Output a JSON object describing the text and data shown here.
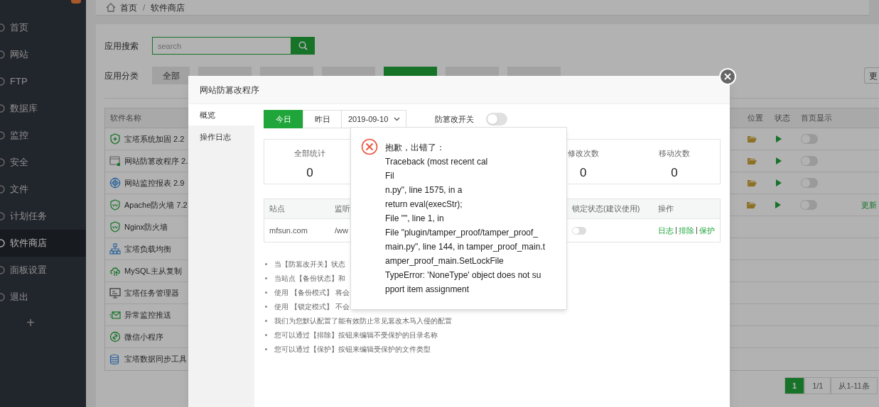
{
  "breadcrumb": [
    "首页",
    "/",
    "软件商店"
  ],
  "sidebar": {
    "items": [
      {
        "label": "首页",
        "selected": false
      },
      {
        "label": "网站",
        "selected": false
      },
      {
        "label": "FTP",
        "selected": false
      },
      {
        "label": "数据库",
        "selected": false
      },
      {
        "label": "监控",
        "selected": false
      },
      {
        "label": "安全",
        "selected": false
      },
      {
        "label": "文件",
        "selected": false
      },
      {
        "label": "计划任务",
        "selected": false
      },
      {
        "label": "软件商店",
        "selected": true
      },
      {
        "label": "面板设置",
        "selected": false
      },
      {
        "label": "退出",
        "selected": false
      }
    ],
    "add": "+"
  },
  "search": {
    "label": "应用搜索",
    "placeholder": "search"
  },
  "categories": {
    "label": "应用分类",
    "tabs": [
      {
        "label": "全部",
        "selected": false
      },
      {
        "selected": false
      },
      {
        "selected": false
      },
      {
        "selected": false
      },
      {
        "selected": true
      },
      {
        "selected": false
      },
      {
        "selected": false
      }
    ],
    "more": "更"
  },
  "table": {
    "columns": [
      "软件名称",
      "位置",
      "状态",
      "首页显示"
    ],
    "rows": [
      {
        "name": "宝塔系统加固 2.2",
        "kind": "shield",
        "installed": true,
        "home_display": false
      },
      {
        "name": "网站防篡改程序 2.",
        "kind": "window",
        "installed": true,
        "home_display": false
      },
      {
        "name": "网站监控报表 2.9",
        "kind": "target",
        "installed": true,
        "home_display": false
      },
      {
        "name": "Apache防火墙 7.2",
        "kind": "waf",
        "installed": true,
        "home_display": false,
        "action": "更新"
      },
      {
        "name": "Nginx防火墙",
        "kind": "waf",
        "installed": false
      },
      {
        "name": "宝塔负载均衡",
        "kind": "network",
        "installed": false
      },
      {
        "name": "MySQL主从复制",
        "kind": "cloud",
        "installed": false
      },
      {
        "name": "宝塔任务管理器",
        "kind": "monitor",
        "installed": false
      },
      {
        "name": "异常监控推送",
        "kind": "mail",
        "installed": false
      },
      {
        "name": "微信小程序",
        "kind": "link",
        "installed": false
      },
      {
        "name": "宝塔数据同步工具",
        "kind": "database",
        "installed": false
      }
    ]
  },
  "pagination": [
    {
      "label": "1",
      "selected": true
    },
    {
      "label": "1/1",
      "selected": false
    },
    {
      "label": "从1-11条",
      "selected": false
    }
  ],
  "modal": {
    "title": "网站防篡改程序",
    "tabs": [
      {
        "label": "概览",
        "selected": true
      },
      {
        "label": "操作日志",
        "selected": false
      }
    ],
    "day_buttons": [
      {
        "label": "今日",
        "selected": true
      },
      {
        "label": "昨日",
        "selected": false
      }
    ],
    "date": "2019-09-10",
    "switch": {
      "label": "防篡改开关",
      "on": false
    },
    "stats": [
      {
        "kind": "stat",
        "label": "全部统计",
        "value": "0"
      },
      {
        "kind": "hidden"
      },
      {
        "kind": "hidden"
      },
      {
        "kind": "stat",
        "label": "修改次数",
        "value": "0"
      },
      {
        "kind": "stat",
        "label": "移动次数",
        "value": "0"
      }
    ],
    "site_table": {
      "columns": [
        "站点",
        "监听",
        "锁定状态(建议使用)",
        "操作"
      ],
      "rows": [
        {
          "site": "mfsun.com",
          "path": "/ww",
          "locked": false,
          "actions": [
            "日志",
            "排除",
            "保护"
          ]
        }
      ]
    },
    "notes": [
      "当【防篡改开关】状态",
      "当站点【备份状态】和",
      "使用 【备份模式】 将会",
      "使用 【锁定模式】 不会",
      "我们为您默认配置了能有效防止常见篡改木马入侵的配置",
      "您可以通过【排除】按钮来编辑不受保护的目录名称",
      "您可以通过【保护】按钮来编辑受保护的文件类型"
    ]
  },
  "error": {
    "title": "抱歉，出错了：",
    "lines": [
      "Traceback (most recent cal",
      "Fil",
      "n.py\", line 1575, in a",
      "return eval(execStr);",
      "File \"\", line 1, in",
      "File \"plugin/tamper_proof/tamper_proof_",
      "main.py\", line 144, in tamper_proof_main.t",
      "amper_proof_main.SetLockFile",
      "TypeError: 'NoneType' object does not su",
      "pport item assignment"
    ]
  }
}
